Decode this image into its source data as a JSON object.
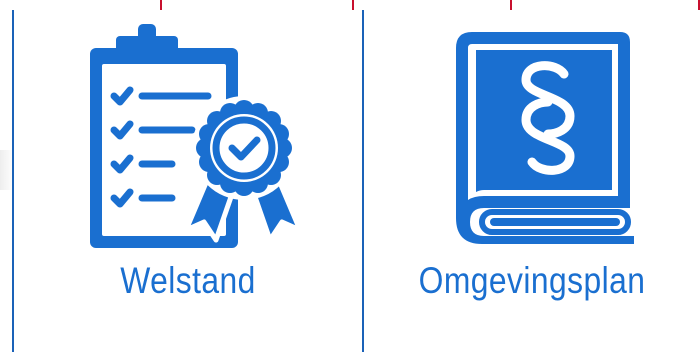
{
  "tiles": [
    {
      "label": "Welstand",
      "icon": "clipboard-checklist-award-icon"
    },
    {
      "label": "Omgevingsplan",
      "icon": "law-book-paragraph-icon"
    }
  ],
  "colors": {
    "accent_blue": "#1a6fd0",
    "border_blue": "#1a62b8",
    "header_red": "#c8102e"
  }
}
